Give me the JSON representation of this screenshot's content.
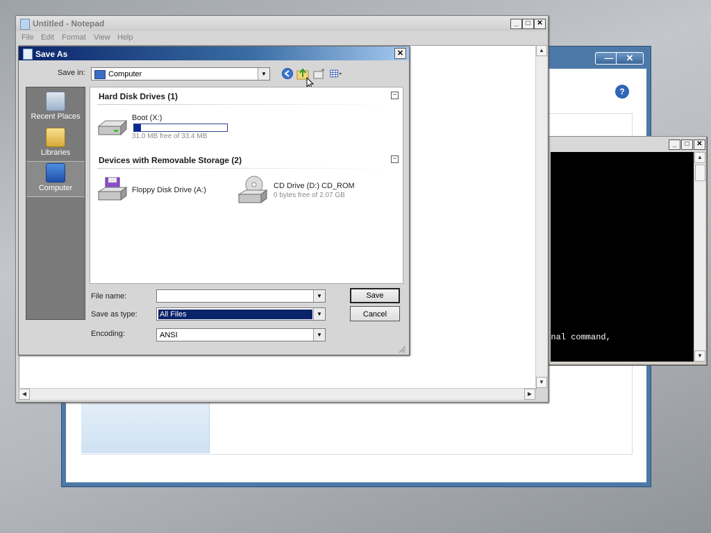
{
  "notepad": {
    "title": "Untitled - Notepad",
    "menu": [
      "File",
      "Edit",
      "Format",
      "View",
      "Help"
    ],
    "caption_buttons": {
      "minimize": "_",
      "maximize": "□",
      "close": "✕"
    }
  },
  "console": {
    "visible_text": "ernal command,",
    "caption_buttons": {
      "minimize": "_",
      "maximize": "□",
      "close": "✕"
    }
  },
  "setup_window": {
    "caption_buttons": {
      "minimize": "—",
      "close": "✕"
    },
    "help_icon": "?"
  },
  "save_as": {
    "title": "Save As",
    "close": "✕",
    "save_in_label": "Save in:",
    "save_in_value": "Computer",
    "places": [
      {
        "label": "Recent Places",
        "icon": "recent-places-icon"
      },
      {
        "label": "Libraries",
        "icon": "libraries-icon"
      },
      {
        "label": "Computer",
        "icon": "computer-icon",
        "active": true
      }
    ],
    "groups": [
      {
        "header": "Hard Disk Drives (1)",
        "collapse": "−",
        "items": [
          {
            "name": "Boot (X:)",
            "detail": "31.0 MB free of 33.4 MB",
            "used_fraction": 0.072,
            "icon": "hard-drive-icon"
          }
        ]
      },
      {
        "header": "Devices with Removable Storage (2)",
        "collapse": "−",
        "items": [
          {
            "name": "Floppy Disk Drive (A:)",
            "icon": "floppy-drive-icon"
          },
          {
            "name": "CD Drive (D:) CD_ROM",
            "detail": "0 bytes free of 2.07 GB",
            "icon": "cd-drive-icon"
          }
        ]
      }
    ],
    "file_name_label": "File name:",
    "file_name_value": "",
    "save_as_type_label": "Save as type:",
    "save_as_type_value": "All Files",
    "encoding_label": "Encoding:",
    "encoding_value": "ANSI",
    "save_button": "Save",
    "cancel_button": "Cancel"
  },
  "colors": {
    "title_gradient_start": "#0a246a",
    "selection": "#0a246a",
    "capacity_fill": "#0c2a8c",
    "setup_frame": "#4d79a8"
  }
}
